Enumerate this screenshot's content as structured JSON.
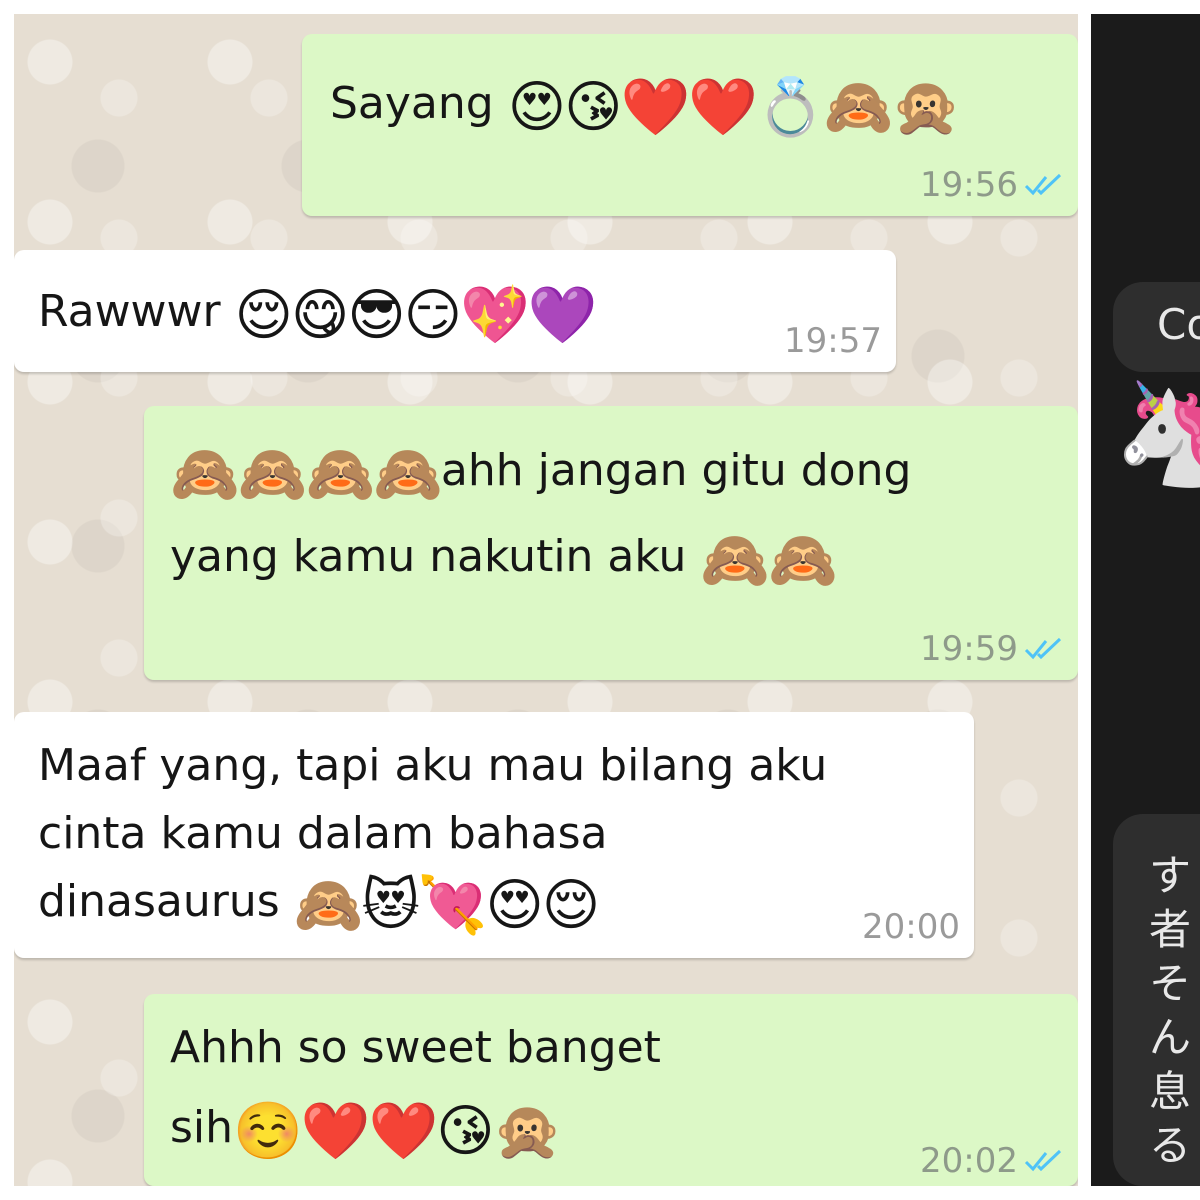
{
  "messages": [
    {
      "text": "Sayang ",
      "emoji": "😍😘❤️❤️💍🙈🙊",
      "time": "19:56"
    },
    {
      "text": "Rawwwr ",
      "emoji": "😌😋😎😏💖💜",
      "time": "19:57"
    },
    {
      "line1_emoji": "🙈🙈🙈🙈",
      "line1_text": "ahh jangan gitu dong",
      "line2_text": "yang kamu nakutin aku ",
      "line2_emoji": "🙈🙈",
      "time": "19:59"
    },
    {
      "line1": "Maaf yang, tapi aku mau bilang aku",
      "line2": "cinta kamu dalam bahasa",
      "line3_text": "dinasaurus ",
      "line3_emoji": "🙈😻💘😍😌",
      "time": "20:00"
    },
    {
      "line1": "Ahhh so sweet banget",
      "line2_text": "sih",
      "line2_emoji": "☺️❤️❤️😘🙊",
      "time": "20:02"
    }
  ],
  "side_panel": {
    "bubble_text": "Co",
    "emoji": "🦄",
    "jp_text": "す\n者\nそ\nん\n息\nる"
  },
  "colors": {
    "outgoing_bubble": "#dcf8c6",
    "incoming_bubble": "#ffffff",
    "read_ticks": "#4fc3f7",
    "chat_background": "#e6ded2",
    "side_background": "#1b1b1b"
  }
}
